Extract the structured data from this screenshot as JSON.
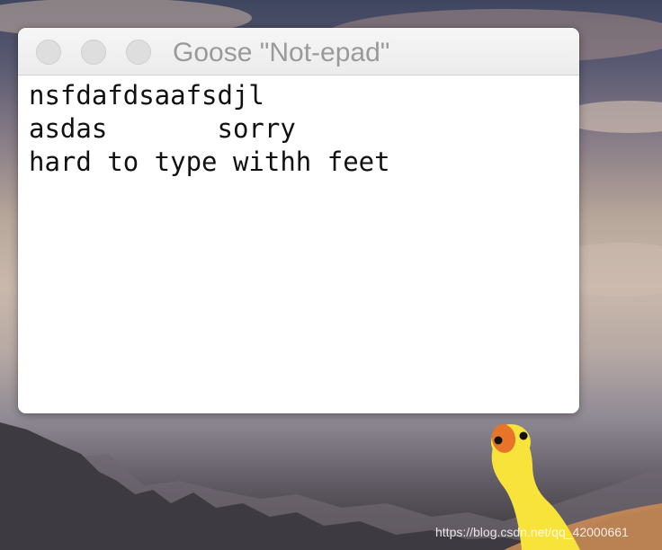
{
  "window": {
    "title": "Goose \"Not-epad\""
  },
  "editor": {
    "lines": [
      "nsfdafdsaafsdjl",
      "asdas       sorry",
      "hard to type withh feet"
    ]
  },
  "watermark": "https://blog.csdn.net/qq_42000661",
  "colors": {
    "goose_body": "#f7e33a",
    "goose_beak": "#e8742a",
    "traffic_light_inactive": "#dedede",
    "title_text": "#9a9a9a"
  }
}
